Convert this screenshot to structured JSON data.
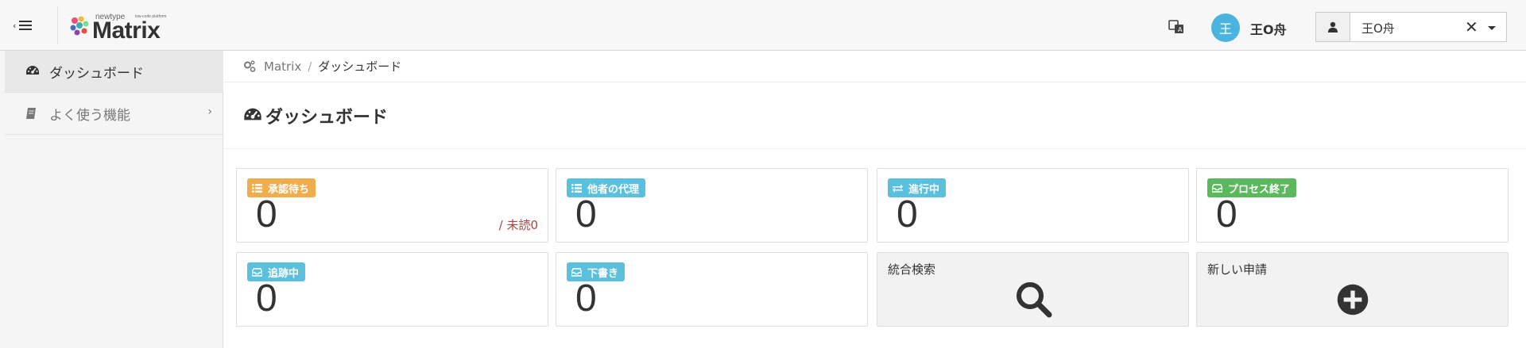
{
  "header": {
    "logo_small": "newtype",
    "logo_tiny": "low-code platform",
    "logo_big": "Matrix",
    "avatar_char": "王",
    "user_name": "王O舟",
    "user_select_value": "王O舟",
    "clear_symbol": "✕"
  },
  "sidebar": {
    "items": [
      {
        "label": "ダッシュボード",
        "icon": "dashboard-icon"
      },
      {
        "label": "よく使う機能",
        "icon": "book-icon"
      }
    ]
  },
  "breadcrumb": {
    "root": "Matrix",
    "separator": "/",
    "current": "ダッシュボード"
  },
  "page": {
    "title": "ダッシュボード"
  },
  "cards": {
    "pending": {
      "label": "承認待ち",
      "count": "0",
      "unread": "/ 未読0",
      "color": "#f0ad4e"
    },
    "proxy": {
      "label": "他者の代理",
      "count": "0",
      "color": "#5bc0de"
    },
    "in_progress": {
      "label": "進行中",
      "count": "0",
      "color": "#5bc0de"
    },
    "completed": {
      "label": "プロセス終了",
      "count": "0",
      "color": "#5cb85c"
    },
    "tracking": {
      "label": "追跡中",
      "count": "0",
      "color": "#5bc0de"
    },
    "drafts": {
      "label": "下書き",
      "count": "0",
      "color": "#5bc0de"
    },
    "search": {
      "label": "統合検索",
      "icon": "search-icon"
    },
    "new_request": {
      "label": "新しい申請",
      "icon": "plus-circle-icon"
    }
  }
}
